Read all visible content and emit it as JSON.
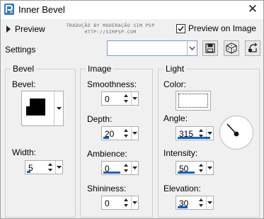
{
  "window": {
    "title": "Inner Bevel",
    "close_glyph": "✕"
  },
  "top": {
    "preview_label": "Preview",
    "preview_on_image_label": "Preview on Image",
    "preview_on_image_checked": true,
    "watermark_line1": "TRADUÇÃO BY MODERAÇÃO SIM PSP",
    "watermark_line2": "HTTP://SIMPSP.COM"
  },
  "settings": {
    "label": "Settings",
    "value": ""
  },
  "toolbar": {
    "icons": [
      "save-icon",
      "randomize-dice-icon",
      "reset-icon"
    ]
  },
  "bevel_group": {
    "title": "Bevel",
    "bevel_label": "Bevel:",
    "width_label": "Width:",
    "width_value": "5"
  },
  "image_group": {
    "title": "Image",
    "smoothness_label": "Smoothness:",
    "smoothness_value": "0",
    "depth_label": "Depth:",
    "depth_value": "20",
    "ambience_label": "Ambience:",
    "ambience_value": "0",
    "shininess_label": "Shininess:",
    "shininess_value": "0"
  },
  "light_group": {
    "title": "Light",
    "color_label": "Color:",
    "color_value": "#ffffff",
    "angle_label": "Angle:",
    "angle_value": "315",
    "intensity_label": "Intensity:",
    "intensity_value": "50",
    "elevation_label": "Elevation:",
    "elevation_value": "30"
  },
  "colors": {
    "accent": "#0b62c9",
    "window_bg": "#f0f0f0"
  }
}
